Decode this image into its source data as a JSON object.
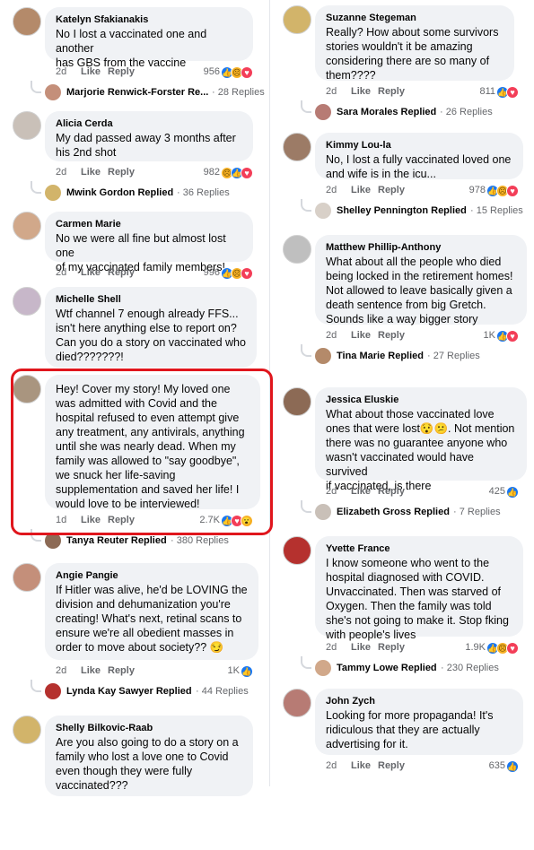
{
  "left": [
    {
      "author": "Katelyn Sfakianakis",
      "text": "No I lost a vaccinated one and another\nhas GBS from the vaccine",
      "time": "2d",
      "like": "Like",
      "reply": "Reply",
      "count": "956",
      "reactions": [
        "like",
        "sad",
        "love"
      ],
      "thread": {
        "name": "Marjorie Renwick-Forster Re...",
        "info": "· 28 Replies"
      }
    },
    {
      "author": "Alicia Cerda",
      "text": "My dad passed away 3 months after\nhis 2nd shot",
      "time": "2d",
      "like": "Like",
      "reply": "Reply",
      "count": "982",
      "reactions": [
        "sad",
        "like",
        "love"
      ],
      "thread": {
        "name": "Mwink Gordon Replied",
        "info": "· 36 Replies"
      }
    },
    {
      "author": "Carmen Marie",
      "text": "No we were all fine but almost lost one\nof my vaccinated family members!",
      "time": "2d",
      "like": "Like",
      "reply": "Reply",
      "count": "996",
      "reactions": [
        "like",
        "sad",
        "love"
      ],
      "thread": null
    },
    {
      "author": "Michelle Shell",
      "text": "Wtf channel 7 enough already FFS...\nisn't here anything else to report on?\nCan you do a story on vaccinated who\ndied???????!",
      "time": "",
      "like": "",
      "reply": "",
      "count": "",
      "reactions": [],
      "thread": null
    },
    {
      "author": "",
      "text": "Hey! Cover my story! My loved one\nwas admitted with Covid and the\nhospital refused to even attempt give\nany treatment, any antivirals, anything\nuntil she was nearly dead. When my\nfamily was allowed to \"say goodbye\",\nwe snuck her life-saving\nsupplementation and saved her life! I\nwould love to be interviewed!",
      "time": "1d",
      "like": "Like",
      "reply": "Reply",
      "count": "2.7K",
      "reactions": [
        "like",
        "love",
        "wow"
      ],
      "thread": {
        "name": "Tanya Reuter Replied",
        "info": "· 380 Replies"
      }
    },
    {
      "author": "Angie Pangie",
      "text": "If Hitler was alive, he'd be LOVING the\ndivision and dehumanization you're\ncreating! What's next, retinal scans to\nensure we're all obedient masses in\norder to move about society?? 😏",
      "time": "2d",
      "like": "Like",
      "reply": "Reply",
      "count": "1K",
      "reactions": [
        "like"
      ],
      "thread": {
        "name": "Lynda Kay Sawyer Replied",
        "info": "· 44 Replies"
      }
    },
    {
      "author": "Shelly Bilkovic-Raab",
      "text": "Are you also going to do a story on a\nfamily who lost a love one to Covid\neven though they were fully\nvaccinated???",
      "time": "",
      "like": "",
      "reply": "",
      "count": "",
      "reactions": [],
      "thread": null
    }
  ],
  "right": [
    {
      "author": "Suzanne Stegeman",
      "text": "Really? How about some survivors\nstories wouldn't it be amazing\nconsidering there are so many of\nthem????",
      "time": "2d",
      "like": "Like",
      "reply": "Reply",
      "count": "811",
      "reactions": [
        "like",
        "love"
      ],
      "thread": {
        "name": "Sara Morales Replied",
        "info": "· 26 Replies"
      }
    },
    {
      "author": "Kimmy Lou-la",
      "text": "No, I lost a fully vaccinated loved one\nand wife is in the icu...",
      "time": "2d",
      "like": "Like",
      "reply": "Reply",
      "count": "978",
      "reactions": [
        "like",
        "sad",
        "love"
      ],
      "thread": {
        "name": "Shelley Pennington Replied",
        "info": "· 15 Replies"
      }
    },
    {
      "author": "Matthew Phillip-Anthony",
      "text": "What about all the people who died\nbeing locked in the retirement homes!\nNot allowed to leave basically given a\ndeath sentence from big Gretch.\nSounds like a way bigger story",
      "time": "2d",
      "like": "Like",
      "reply": "Reply",
      "count": "1K",
      "reactions": [
        "like",
        "love"
      ],
      "thread": {
        "name": "Tina Marie Replied",
        "info": "· 27 Replies"
      }
    },
    {
      "author": "Jessica Eluskie",
      "text": "What about those vaccinated love\nones that were lost😯😕. Not mention\nthere was no guarantee anyone who\nwasn't vaccinated would have survived\nif vaccinated, is there",
      "time": "2d",
      "like": "Like",
      "reply": "Reply",
      "count": "425",
      "reactions": [
        "like"
      ],
      "thread": {
        "name": "Elizabeth Gross Replied",
        "info": "· 7 Replies"
      }
    },
    {
      "author": "Yvette France",
      "text": "I know someone who went to the\nhospital diagnosed with COVID.\nUnvaccinated. Then was starved of\nOxygen. Then the family was told\nshe's not going to make it. Stop fking\nwith people's lives",
      "time": "2d",
      "like": "Like",
      "reply": "Reply",
      "count": "1.9K",
      "reactions": [
        "like",
        "sad",
        "love"
      ],
      "thread": {
        "name": "Tammy Lowe Replied",
        "info": "· 230 Replies"
      }
    },
    {
      "author": "John Zych",
      "text": "Looking for more propaganda! It's\nridiculous that they are actually\nadvertising for it.",
      "time": "2d",
      "like": "Like",
      "reply": "Reply",
      "count": "635",
      "reactions": [
        "like"
      ],
      "thread": null
    }
  ],
  "colors": {
    "highlight": "#e0161d",
    "bubble": "#f0f2f5",
    "like": "#1877f2",
    "love": "#f33e58",
    "sad": "#f7b125"
  },
  "reaction_glyphs": {
    "like": "👍",
    "love": "♥",
    "sad": "☹",
    "wow": "😮"
  }
}
